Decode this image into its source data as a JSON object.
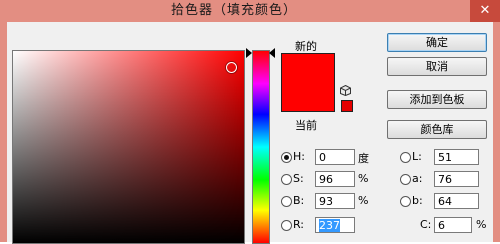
{
  "window": {
    "title": "拾色器（填充颜色）",
    "close_glyph": "✕"
  },
  "swatches": {
    "new_label": "新的",
    "current_label": "当前",
    "new_color": "#ff0000",
    "current_color": "#ff0000",
    "websafe_color": "#e50000"
  },
  "buttons": {
    "ok": "确定",
    "cancel": "取消",
    "add_to_swatches": "添加到色板",
    "color_libraries": "颜色库"
  },
  "hsb": {
    "h": {
      "label": "H:",
      "value": "0",
      "unit": "度"
    },
    "s": {
      "label": "S:",
      "value": "96",
      "unit": "%"
    },
    "b": {
      "label": "B:",
      "value": "93",
      "unit": "%"
    }
  },
  "lab": {
    "l": {
      "label": "L:",
      "value": "51"
    },
    "a": {
      "label": "a:",
      "value": "76"
    },
    "b": {
      "label": "b:",
      "value": "64"
    }
  },
  "rgb": {
    "r": {
      "label": "R:",
      "value": "237"
    }
  },
  "cmyk": {
    "c": {
      "label": "C:",
      "value": "6",
      "unit": "%"
    }
  },
  "icons": {
    "close": "close-icon",
    "cube": "cube-icon"
  }
}
